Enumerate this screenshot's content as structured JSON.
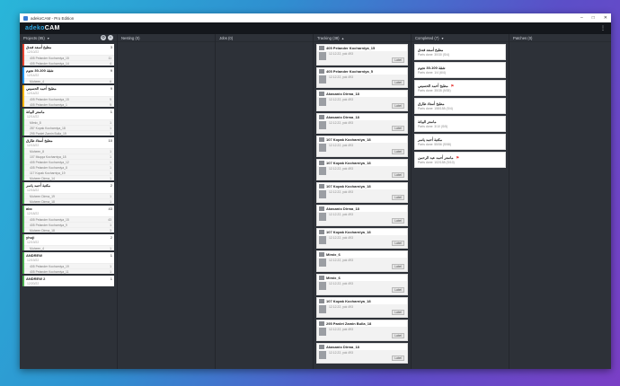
{
  "window": {
    "title": "adekoCAM - Pro Edition",
    "controls": [
      "–",
      "□",
      "✕"
    ]
  },
  "app": {
    "logo_a": "adeko",
    "logo_b": "CAM",
    "menu_icon": "⋮"
  },
  "columns": {
    "projects": {
      "label": "Projects (85)"
    },
    "nesting": {
      "label": "Nesting (0)"
    },
    "jobs": {
      "label": "Jobs (0)"
    },
    "tracking": {
      "label": "Tracking (38)"
    },
    "completed": {
      "label": "Completed (7)"
    },
    "patches": {
      "label": "Patches (0)"
    }
  },
  "projects": [
    {
      "name": "مطبخ أسعد فندق",
      "date": "12/10/22",
      "count": "3",
      "color": "#e8442f",
      "subs": [
        {
          "name": "405 Pelander Kocharniya_15",
          "n": "11"
        },
        {
          "name": "405 Pelander Kocharniya_14",
          "n": "4"
        }
      ]
    },
    {
      "name": "شقة 100-30 نجوم",
      "date": "12/14/22",
      "count": "9",
      "color": "#2196f3",
      "subs": [
        {
          "name": "Muheen_4",
          "n": "6"
        }
      ]
    },
    {
      "name": "مطبخ أحمد الحسيني",
      "date": "12/14/22",
      "count": "9",
      "color": "#ffb300",
      "subs": [
        {
          "name": "405 Pelander Kocharniya_15",
          "n": "9"
        },
        {
          "name": "405 Pelander Kocharniya_1",
          "n": "9"
        }
      ]
    },
    {
      "name": "ماستر البيانة",
      "date": "12/14/22",
      "count": "1",
      "color": "#4caf50",
      "subs": [
        {
          "name": "Mimix_8",
          "n": "1"
        },
        {
          "name": "287 Kopak Kocharniya_18",
          "n": "1"
        },
        {
          "name": "295 Panlet Zamin Bulla_19",
          "n": "1"
        }
      ]
    },
    {
      "name": "مطبخ أستاذ طارق",
      "date": "12/15/22",
      "count": "10",
      "color": "#4caf50",
      "subs": [
        {
          "name": "Muheen_8",
          "n": "1"
        },
        {
          "name": "107 Muqqa Kocharniya_18",
          "n": "1"
        },
        {
          "name": "405 Pelander Kocharniya_12",
          "n": "1"
        },
        {
          "name": "405 Pelander Kocharniya_8",
          "n": "1"
        },
        {
          "name": "117 Kopak Kocharniya_19",
          "n": "1"
        },
        {
          "name": "Muheen Dirma_14",
          "n": "1"
        }
      ]
    },
    {
      "name": "مكتبة أحمد ياسر",
      "date": "12/16/22",
      "count": "2",
      "color": "#4caf50",
      "subs": [
        {
          "name": "Muheen Dirma_19",
          "n": "1"
        },
        {
          "name": "Muheen Dirma_18",
          "n": "1"
        }
      ]
    },
    {
      "name": "abc",
      "date": "12/18/22",
      "count": "43",
      "color": "#4caf50",
      "subs": [
        {
          "name": "405 Pelander Kocharniya_15",
          "n": "43"
        },
        {
          "name": "405 Pelander Kocharniya_9",
          "n": "1"
        },
        {
          "name": "Muheen Dirma_18",
          "n": "3"
        }
      ]
    },
    {
      "name": "yhuji",
      "date": "12/19/22",
      "count": "2",
      "color": "#4caf50",
      "subs": [
        {
          "name": "Muheen_4",
          "n": "1"
        }
      ]
    },
    {
      "name": "ANDREW",
      "date": "12/19/22",
      "count": "1",
      "color": "#4caf50",
      "subs": [
        {
          "name": "405 Pelander Kocharniya_19",
          "n": "1"
        },
        {
          "name": "405 Pelander Kocharniya_11",
          "n": "1"
        }
      ]
    },
    {
      "name": "ANDREW 2",
      "date": "12/20/22",
      "count": "1",
      "color": "#4caf50",
      "subs": []
    }
  ],
  "tracking": [
    {
      "name": "405 Pelander Kocharniya_15",
      "date": "12.12.22, yok 493",
      "label": "Label"
    },
    {
      "name": "405 Pelander Kocharniya_5",
      "date": "12.12.22, yok 493",
      "label": "Label"
    },
    {
      "name": "Akasanio Dirma_18",
      "date": "12.12.22, yok 493",
      "label": "Label"
    },
    {
      "name": "Akasanio Dirma_18",
      "date": "12.12.22, yok 493",
      "label": "Label"
    },
    {
      "name": "107 Kopak Kocharniya_18",
      "date": "12.12.22, yok 493",
      "label": "Label"
    },
    {
      "name": "107 Kopak Kocharniya_18",
      "date": "12.12.22, yok 493",
      "label": "Label"
    },
    {
      "name": "107 Kopak Kocharniya_18",
      "date": "12.12.22, yok 493",
      "label": "Label"
    },
    {
      "name": "Akasanio Dirma_18",
      "date": "12.12.22, yok 493",
      "label": "Label"
    },
    {
      "name": "107 Kopak Kocharniya_18",
      "date": "12.12.22, yok 493",
      "label": "Label"
    },
    {
      "name": "Mimix_6",
      "date": "12.12.22, yok 493",
      "label": "Label"
    },
    {
      "name": "Mimix_6",
      "date": "12.12.22, yok 493",
      "label": "Label"
    },
    {
      "name": "107 Kopak Kocharniya_18",
      "date": "12.12.22, yok 493",
      "label": "Label"
    },
    {
      "name": "295 Panlet Zamin Bulla_18",
      "date": "12.12.22, yok 493",
      "label": "Label"
    },
    {
      "name": "Akasanio Dirma_18",
      "date": "12.12.22, yok 493",
      "label": "Label"
    }
  ],
  "completed": [
    {
      "name": "مطبخ أسعد فندق",
      "status": "Parts done: 30/30 (S/4)",
      "flag": ""
    },
    {
      "name": "شقة 100-30 نجوم",
      "status": "Parts done: 1/4 (6/4)",
      "flag": ""
    },
    {
      "name": "مطبخ أحمد الحسيني",
      "status": "Parts done: 35/35 (9/35)",
      "flag": "⚑"
    },
    {
      "name": "مطبخ أستاذ طارق",
      "status": "Parts done: 158/158 (S/4)",
      "flag": ""
    },
    {
      "name": "ماستر البيانة",
      "status": "Parts done: 3/10 (S/5)",
      "flag": ""
    },
    {
      "name": "مكتبة أحمد ياسر",
      "status": "Parts done: 55/56 (S/58)",
      "flag": ""
    },
    {
      "name": "ماستر أحمد عبد الرحمن",
      "status": "Parts done: 102/158 (S/10)",
      "flag": "⚑"
    }
  ]
}
